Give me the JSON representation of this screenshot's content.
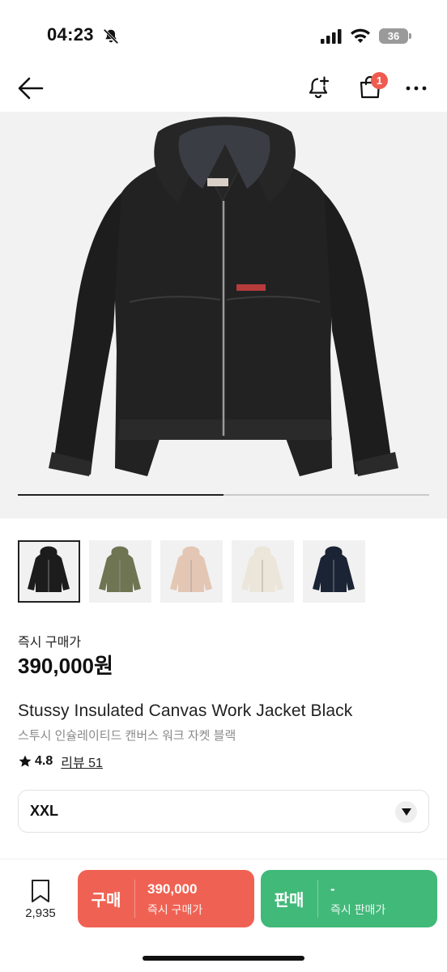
{
  "status_bar": {
    "time": "04:23",
    "battery": "36",
    "icons": [
      "bell-slash-icon",
      "signal-icon",
      "wifi-icon",
      "battery-icon"
    ]
  },
  "header": {
    "icons": [
      "back-arrow-icon",
      "alarm-add-icon",
      "shopping-bag-icon",
      "more-icon"
    ],
    "cart_badge": "1"
  },
  "gallery": {
    "progress": 0.5,
    "thumbnails": [
      {
        "color": "#1c1c1c",
        "selected": true
      },
      {
        "color": "#6f7452",
        "selected": false
      },
      {
        "color": "#e3c7b4",
        "selected": false
      },
      {
        "color": "#ece6da",
        "selected": false
      },
      {
        "color": "#1a2434",
        "selected": false
      }
    ]
  },
  "price": {
    "label": "즉시 구매가",
    "value": "390,000원"
  },
  "product": {
    "name": "Stussy Insulated Canvas Work Jacket Black",
    "name_ko": "스투시 인슐레이티드 캔버스 워크 자켓 블랙",
    "rating": "4.8",
    "reviews": "리뷰 51"
  },
  "size_select": {
    "value": "XXL"
  },
  "bottom_bar": {
    "wish_count": "2,935",
    "buy": {
      "label": "구매",
      "price": "390,000",
      "sub": "즉시 구매가",
      "color": "#ef6253"
    },
    "sell": {
      "label": "판매",
      "price": "-",
      "sub": "즉시 판매가",
      "color": "#41b979"
    }
  }
}
